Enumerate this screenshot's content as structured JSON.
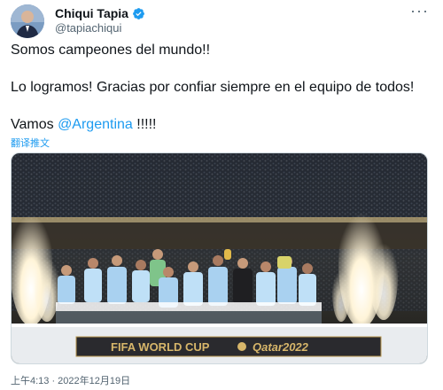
{
  "author": {
    "name": "Chiqui Tapia",
    "handle": "@tapiachiqui",
    "verified": true,
    "verified_color": "#1d9bf0"
  },
  "more_icon": "more-dots-icon",
  "tweet": {
    "line1": "Somos campeones del mundo!!",
    "line2": "Lo logramos! Gracias por confiar siempre en el equipo de todos!",
    "line3_prefix": "Vamos ",
    "line3_mention": "@Argentina",
    "line3_suffix": " !!!!!"
  },
  "translate_label": "翻译推文",
  "media": {
    "banner_text_left": "FIFA WORLD CUP",
    "banner_text_right": "Qatar2022"
  },
  "timestamp": "上午4:13 · 2022年12月19日",
  "colors": {
    "link": "#1d9bf0",
    "text": "#0f1419",
    "secondary": "#536471"
  }
}
